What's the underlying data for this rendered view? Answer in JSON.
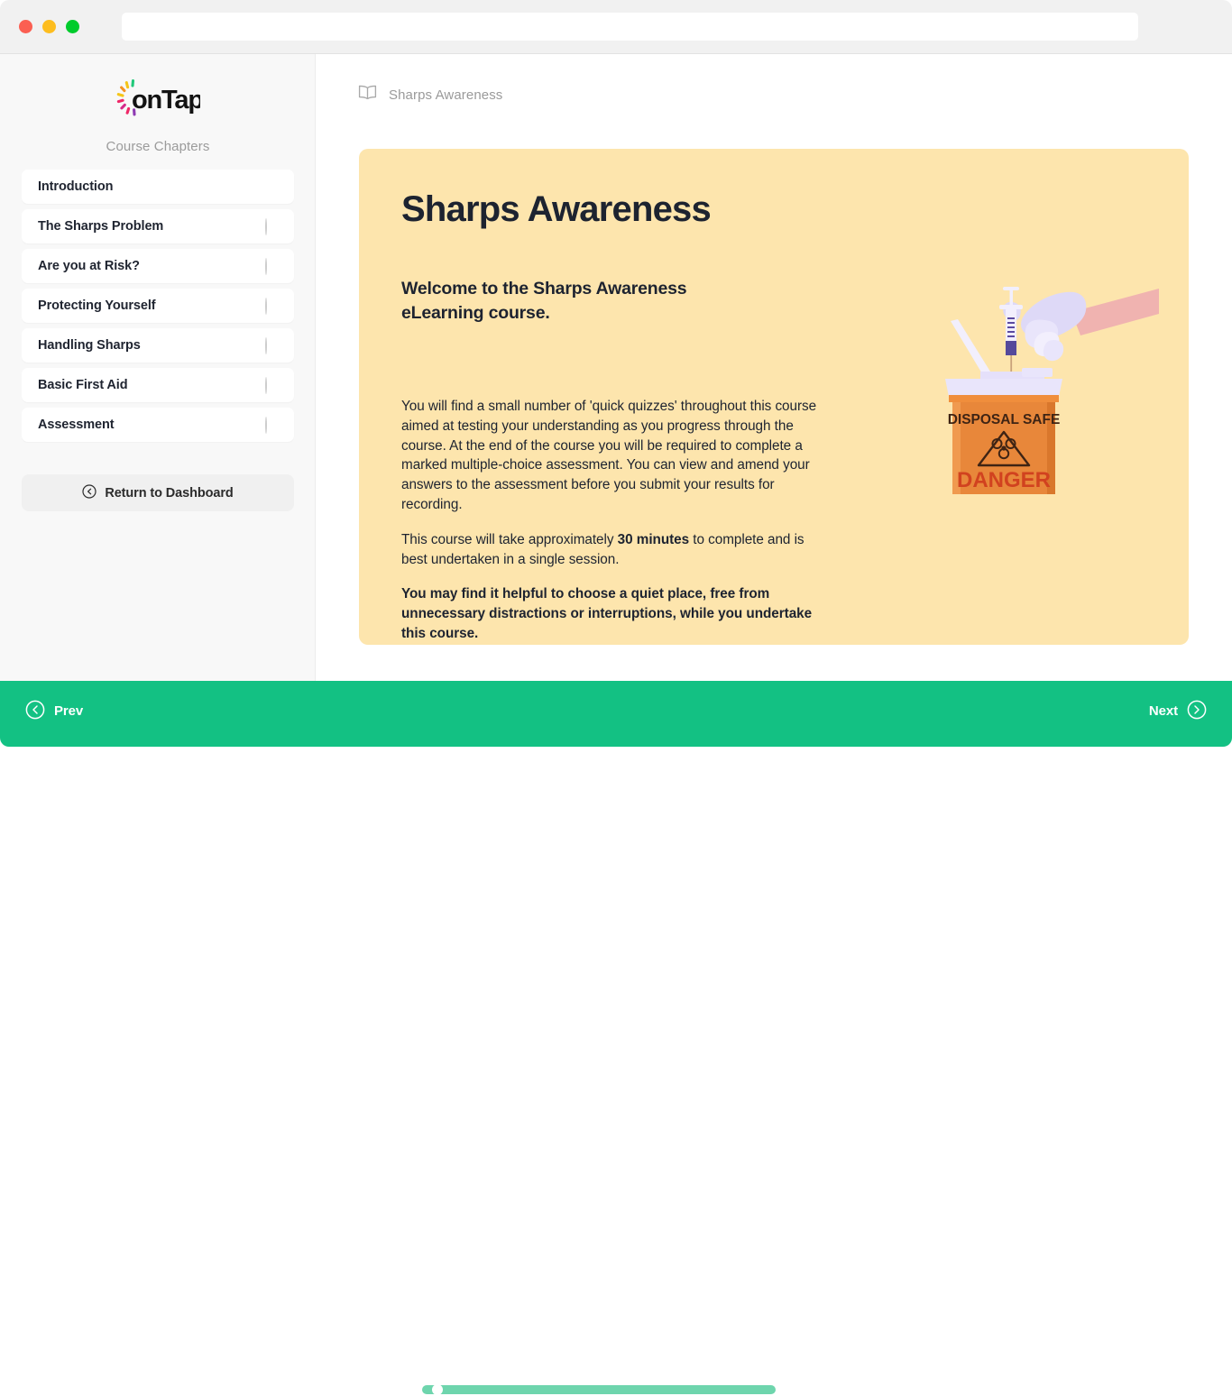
{
  "browser": {
    "url_value": "",
    "url_placeholder": "",
    "traffic_lights": [
      "close",
      "minimize",
      "maximize"
    ]
  },
  "sidebar": {
    "brand": "onTap",
    "section_title": "Course Chapters",
    "chapters": [
      {
        "label": "Introduction",
        "status": "active"
      },
      {
        "label": "The Sharps Problem",
        "status": "pending"
      },
      {
        "label": "Are you at Risk?",
        "status": "pending"
      },
      {
        "label": "Protecting Yourself",
        "status": "pending"
      },
      {
        "label": "Handling Sharps",
        "status": "pending"
      },
      {
        "label": "Basic First Aid",
        "status": "pending"
      },
      {
        "label": "Assessment",
        "status": "pending"
      }
    ],
    "return_button_label": "Return to Dashboard",
    "return_button_icon": "arrow-left-circle-icon"
  },
  "main": {
    "breadcrumb_icon": "open-book-icon",
    "breadcrumb_label": "Sharps Awareness",
    "card": {
      "title": "Sharps Awareness",
      "subtitle": "Welcome to the Sharps Awareness eLearning course.",
      "paragraph_1": "You will find a small number of 'quick quizzes' throughout this course aimed at testing your understanding as you progress through the course.  At the end of the course you will be required to complete a marked multiple-choice assessment. You can view and amend your answers to the assessment before you submit your results for recording.",
      "paragraph_2_pre": "This course will take approximately ",
      "paragraph_2_bold": "30 minutes",
      "paragraph_2_post": " to complete and is best undertaken in a single session.",
      "paragraph_3": "You may find it helpful to choose a quiet place, free from unnecessary distractions or interruptions, while you undertake this course.",
      "illustration": {
        "name": "sharps-disposal-illustration",
        "container_line_1": "DISPOSAL SAFE",
        "container_line_2": "DANGER",
        "symbol": "biohazard-icon"
      }
    }
  },
  "bottom_nav": {
    "prev_label": "Prev",
    "prev_icon": "arrow-left-circle-icon",
    "next_label": "Next",
    "next_icon": "arrow-right-circle-icon",
    "progress_percent_label": "3%",
    "progress_value": 3
  },
  "colors": {
    "accent_green": "#13c183",
    "accent_pink": "#ef2767",
    "card_yellow": "#fde5ad",
    "sidebar_grey": "#f8f8f8",
    "container_orange": "#e8873a",
    "danger_red": "#d1421f"
  }
}
